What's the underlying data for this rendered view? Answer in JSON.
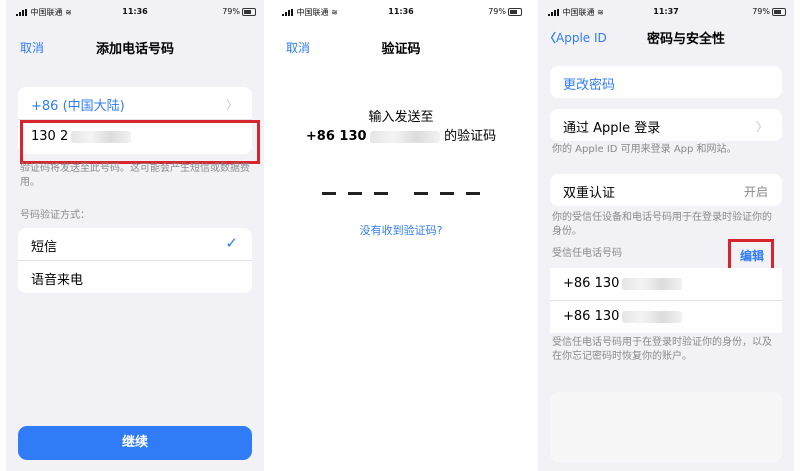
{
  "status": {
    "carrier": "中国联通",
    "battery": "79%",
    "times": [
      "11:36",
      "11:36",
      "11:37"
    ]
  },
  "panel1": {
    "cancel": "取消",
    "title": "添加电话号码",
    "country": "+86 (中国大陆)",
    "phone_input": "130 2",
    "phone_note": "验证码将发送至此号码。这可能会产生短信或数据费用。",
    "method_label": "号码验证方式：",
    "methods": [
      "短信",
      "语音来电"
    ],
    "checkmark": "✓",
    "continue": "继续"
  },
  "panel2": {
    "cancel": "取消",
    "title": "验证码",
    "prompt_line1": "输入发送至",
    "prompt_prefix": "+86 130",
    "prompt_suffix": "的验证码",
    "no_code": "没有收到验证码?"
  },
  "panel3": {
    "back": "Apple ID",
    "title": "密码与安全性",
    "change_password": "更改密码",
    "sign_in_apple": "通过 Apple 登录",
    "sign_in_note": "你的 Apple ID 可用来登录 App 和网站。",
    "two_factor": "双重认证",
    "two_factor_status": "开启",
    "two_factor_note": "你的受信任设备和电话号码用于在登录时验证你的身份。",
    "trusted_label": "受信任电话号码",
    "edit": "编辑",
    "numbers": [
      "+86 130",
      "+86 130"
    ],
    "trusted_note": "受信任电话号码用于在登录时验证你的身份，以及在你忘记密码时恢复你的账户。"
  },
  "colors": {
    "accent": "#2f7cf6",
    "highlight": "#d6252c"
  }
}
